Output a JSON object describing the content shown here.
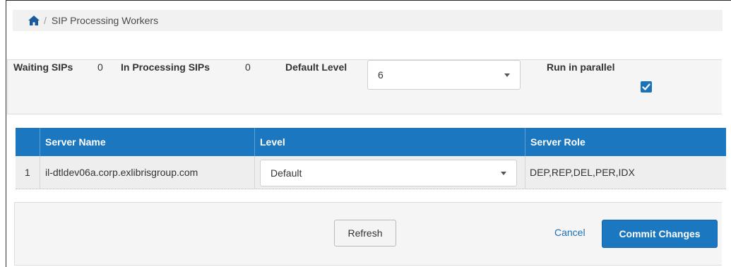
{
  "breadcrumb": {
    "home_icon": "home-icon",
    "separator": "/",
    "current": "SIP Processing Workers"
  },
  "settings": {
    "waiting_label": "Waiting SIPs",
    "waiting_value": "0",
    "processing_label": "In Processing SIPs",
    "processing_value": "0",
    "default_level_label": "Default Level",
    "default_level_value": "6",
    "run_parallel_label": "Run in parallel",
    "run_parallel_checked": true
  },
  "grid": {
    "columns": [
      "Server Name",
      "Level",
      "Server Role"
    ],
    "rows": [
      {
        "index": "1",
        "server_name": "il-dtldev06a.corp.exlibrisgroup.com",
        "level": "Default",
        "server_role": "DEP,REP,DEL,PER,IDX"
      }
    ]
  },
  "actions": {
    "refresh_label": "Refresh",
    "cancel_label": "Cancel",
    "commit_label": "Commit Changes"
  },
  "colors": {
    "accent": "#1a77c0",
    "link": "#1a6fb5",
    "panel_bg": "#f5f5f5"
  }
}
